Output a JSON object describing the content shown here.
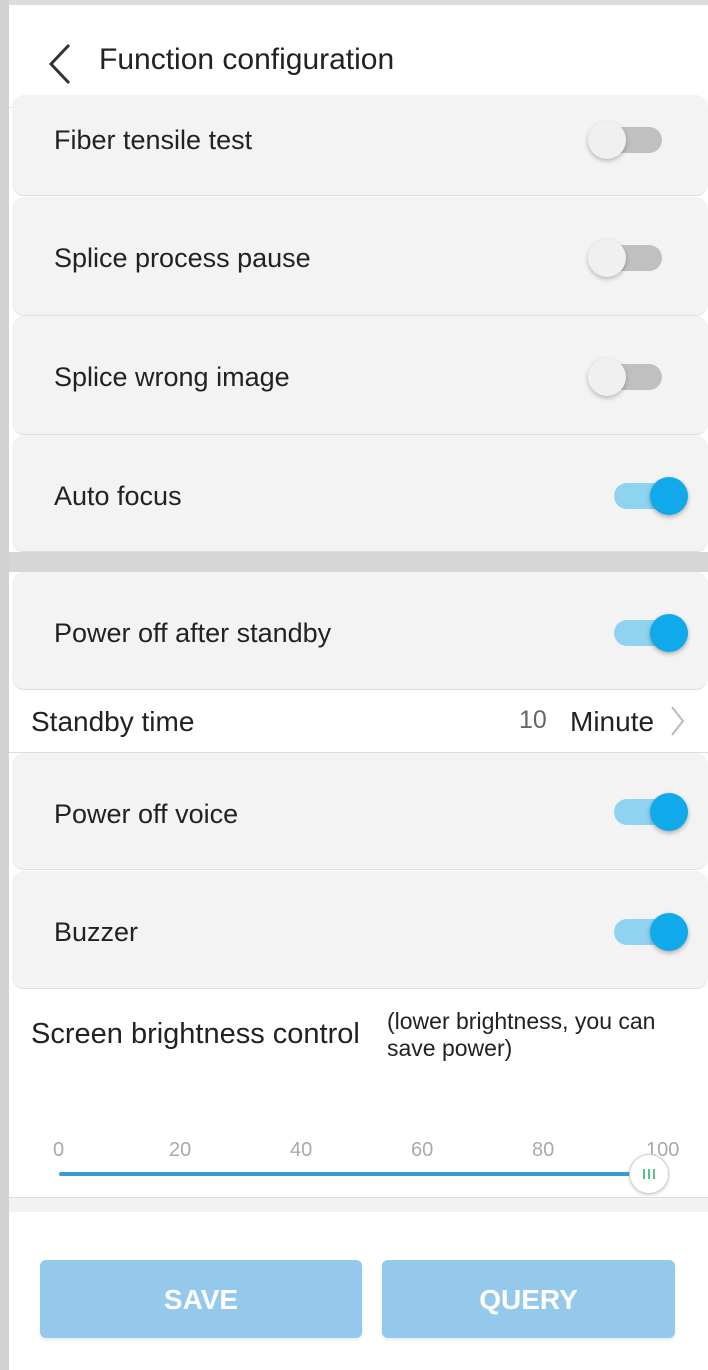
{
  "header": {
    "title": "Function configuration",
    "back_icon": "back-chevron-icon"
  },
  "settings": [
    {
      "label": "Fiber tensile test",
      "enabled": false
    },
    {
      "label": "Splice process pause",
      "enabled": false
    },
    {
      "label": "Splice wrong image",
      "enabled": false
    },
    {
      "label": "Auto focus",
      "enabled": true
    },
    {
      "label": "Power off after standby",
      "enabled": true
    },
    {
      "label": "Power off voice",
      "enabled": true
    },
    {
      "label": "Buzzer",
      "enabled": true
    }
  ],
  "standby": {
    "label": "Standby time",
    "value": "10",
    "unit": "Minute",
    "icon": "chevron-right-icon"
  },
  "brightness": {
    "title": "Screen brightness control",
    "note": "(lower brightness, you can save power)",
    "ticks": [
      "0",
      "20",
      "40",
      "60",
      "80",
      "100"
    ],
    "value": 100,
    "min": 0,
    "max": 100
  },
  "buttons": {
    "save": "SAVE",
    "query": "QUERY"
  },
  "colors": {
    "accent": "#10a9ea",
    "toggle_on_track": "#8fd3f0",
    "toggle_off_track": "#c0c0c0",
    "button_bg": "#95c9ec",
    "slider": "#3a9bd0"
  }
}
